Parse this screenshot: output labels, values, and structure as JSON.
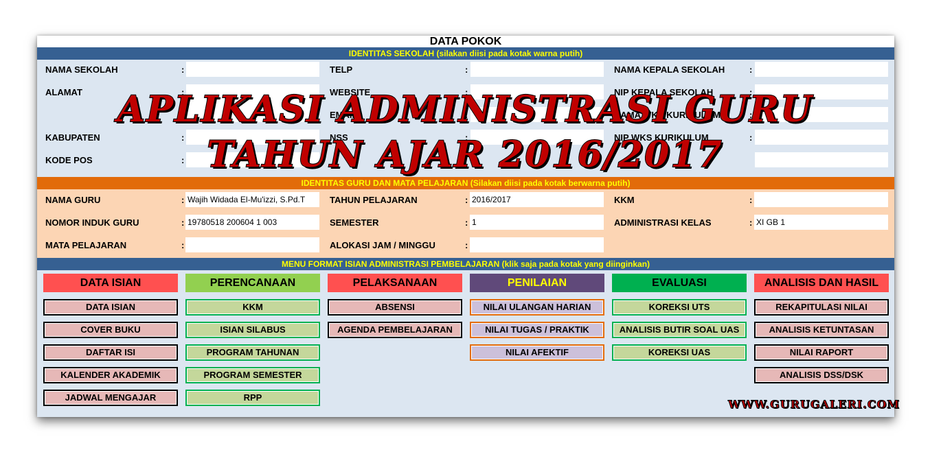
{
  "title": "DATA POKOK",
  "section_school": {
    "header": "IDENTITAS SEKOLAH (silakan diisi pada kotak warna putih)",
    "col1": [
      "NAMA SEKOLAH",
      "ALAMAT",
      "KABUPATEN",
      "KODE POS"
    ],
    "col2": [
      "TELP",
      "WEBSITE",
      "EMAIL",
      "NSS"
    ],
    "col3": [
      "NAMA KEPALA SEKOLAH",
      "NIP KEPALA SEKOLAH",
      "NAMA WKS KURIKULUM",
      "NIP WKS KURIKULUM"
    ]
  },
  "section_teacher": {
    "header": "IDENTITAS GURU DAN MATA PELAJARAN (Silakan diisi pada kotak berwarna putih)",
    "nama_guru_label": "NAMA GURU",
    "nama_guru_value": "Wajih Widada El-Mu'izzi, S.Pd.T",
    "nig_label": "NOMOR INDUK GURU",
    "nig_value": "19780518 200604 1 003",
    "mapel_label": "MATA PELAJARAN",
    "mapel_value": "",
    "tahun_label": "TAHUN PELAJARAN",
    "tahun_value": "2016/2017",
    "semester_label": "SEMESTER",
    "semester_value": "1",
    "alokasi_label": "ALOKASI JAM / MINGGU",
    "alokasi_value": "",
    "kkm_label": "KKM",
    "kkm_value": "",
    "admin_label": "ADMINISTRASI KELAS",
    "admin_value": "XI GB 1"
  },
  "section_menu": {
    "header": "MENU FORMAT ISIAN ADMINISTRASI PEMBELAJARAN (klik saja pada kotak yang diinginkan)",
    "columns": [
      {
        "title": "DATA ISIAN",
        "color": "#ff5050",
        "text_color": "#000000",
        "items": [
          "DATA ISIAN",
          "COVER BUKU",
          "DAFTAR ISI",
          "KALENDER AKADEMIK",
          "JADWAL MENGAJAR"
        ]
      },
      {
        "title": "PERENCANAAN",
        "color": "#92d050",
        "text_color": "#000000",
        "items": [
          "KKM",
          "ISIAN SILABUS",
          "PROGRAM TAHUNAN",
          "PROGRAM SEMESTER",
          "RPP"
        ]
      },
      {
        "title": "PELAKSANAAN",
        "color": "#ff5050",
        "text_color": "#000000",
        "items": [
          "ABSENSI",
          "AGENDA PEMBELAJARAN"
        ]
      },
      {
        "title": "PENILAIAN",
        "color": "#60497a",
        "text_color": "#ffff00",
        "items": [
          "NILAI ULANGAN HARIAN",
          "NILAI TUGAS / PRAKTIK",
          "NILAI AFEKTIF"
        ]
      },
      {
        "title": "EVALUASI",
        "color": "#00b050",
        "text_color": "#000000",
        "items": [
          "KOREKSI UTS",
          "ANALISIS BUTIR SOAL UAS",
          "KOREKSI UAS"
        ]
      },
      {
        "title": "ANALISIS DAN HASIL",
        "color": "#ff5050",
        "text_color": "#000000",
        "items": [
          "REKAPITULASI NILAI",
          "ANALISIS KETUNTASAN",
          "NILAI RAPORT",
          "ANALISIS DSS/DSK"
        ]
      }
    ]
  },
  "overlay": {
    "line1": "APLIKASI ADMINISTRASI GURU",
    "line2": "TAHUN AJAR 2016/2017",
    "color": "#c00000"
  },
  "watermark": "WWW.GURUGALERI.COM"
}
